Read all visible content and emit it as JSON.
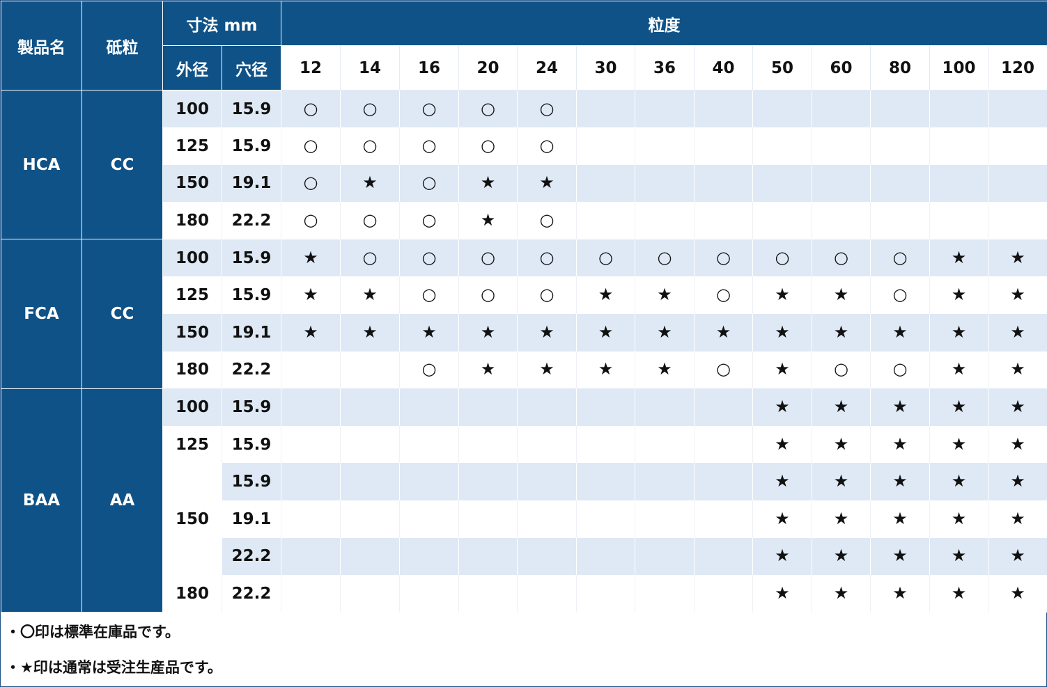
{
  "headers": {
    "product": "製品名",
    "grain": "砥粒",
    "dimensions": "寸法 mm",
    "outer": "外径",
    "bore": "穴径",
    "grit": "粒度"
  },
  "grit_sizes": [
    "12",
    "14",
    "16",
    "20",
    "24",
    "30",
    "36",
    "40",
    "50",
    "60",
    "80",
    "100",
    "120"
  ],
  "groups": [
    {
      "product": "HCA",
      "grain": "CC",
      "rows": [
        {
          "outer": "100",
          "bore": "15.9",
          "marks": [
            "○",
            "○",
            "○",
            "○",
            "○",
            "",
            "",
            "",
            "",
            "",
            "",
            "",
            ""
          ]
        },
        {
          "outer": "125",
          "bore": "15.9",
          "marks": [
            "○",
            "○",
            "○",
            "○",
            "○",
            "",
            "",
            "",
            "",
            "",
            "",
            "",
            ""
          ]
        },
        {
          "outer": "150",
          "bore": "19.1",
          "marks": [
            "○",
            "★",
            "○",
            "★",
            "★",
            "",
            "",
            "",
            "",
            "",
            "",
            "",
            ""
          ]
        },
        {
          "outer": "180",
          "bore": "22.2",
          "marks": [
            "○",
            "○",
            "○",
            "★",
            "○",
            "",
            "",
            "",
            "",
            "",
            "",
            "",
            ""
          ]
        }
      ]
    },
    {
      "product": "FCA",
      "grain": "CC",
      "rows": [
        {
          "outer": "100",
          "bore": "15.9",
          "marks": [
            "★",
            "○",
            "○",
            "○",
            "○",
            "○",
            "○",
            "○",
            "○",
            "○",
            "○",
            "★",
            "★"
          ]
        },
        {
          "outer": "125",
          "bore": "15.9",
          "marks": [
            "★",
            "★",
            "○",
            "○",
            "○",
            "★",
            "★",
            "○",
            "★",
            "★",
            "○",
            "★",
            "★"
          ]
        },
        {
          "outer": "150",
          "bore": "19.1",
          "marks": [
            "★",
            "★",
            "★",
            "★",
            "★",
            "★",
            "★",
            "★",
            "★",
            "★",
            "★",
            "★",
            "★"
          ]
        },
        {
          "outer": "180",
          "bore": "22.2",
          "marks": [
            "",
            "",
            "○",
            "★",
            "★",
            "★",
            "★",
            "○",
            "★",
            "○",
            "○",
            "★",
            "★"
          ]
        }
      ]
    },
    {
      "product": "BAA",
      "grain": "AA",
      "rows": [
        {
          "outer": "100",
          "bore": "15.9",
          "marks": [
            "",
            "",
            "",
            "",
            "",
            "",
            "",
            "",
            "★",
            "★",
            "★",
            "★",
            "★"
          ]
        },
        {
          "outer": "125",
          "bore": "15.9",
          "marks": [
            "",
            "",
            "",
            "",
            "",
            "",
            "",
            "",
            "★",
            "★",
            "★",
            "★",
            "★"
          ]
        },
        {
          "outer": "150",
          "bore": "15.9",
          "marks": [
            "",
            "",
            "",
            "",
            "",
            "",
            "",
            "",
            "★",
            "★",
            "★",
            "★",
            "★"
          ]
        },
        {
          "outer": "",
          "bore": "19.1",
          "marks": [
            "",
            "",
            "",
            "",
            "",
            "",
            "",
            "",
            "★",
            "★",
            "★",
            "★",
            "★"
          ]
        },
        {
          "outer": "",
          "bore": "22.2",
          "marks": [
            "",
            "",
            "",
            "",
            "",
            "",
            "",
            "",
            "★",
            "★",
            "★",
            "★",
            "★"
          ]
        },
        {
          "outer": "180",
          "bore": "22.2",
          "marks": [
            "",
            "",
            "",
            "",
            "",
            "",
            "",
            "",
            "★",
            "★",
            "★",
            "★",
            "★"
          ]
        }
      ]
    }
  ],
  "notes": {
    "standard": "・〇印は標準在庫品です。",
    "made_to_order": "・★印は通常は受注生産品です。"
  },
  "colors": {
    "header_bg": "#0f5287",
    "band_light": "#dee9f5",
    "white": "#ffffff"
  }
}
